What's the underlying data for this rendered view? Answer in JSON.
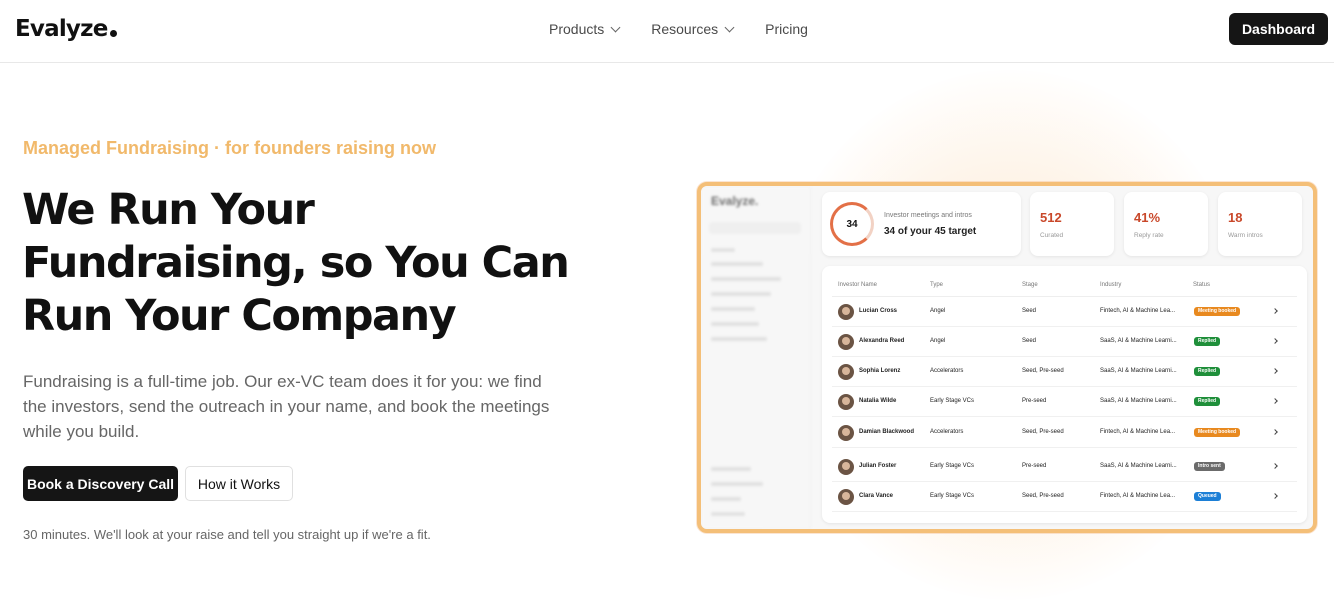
{
  "nav": {
    "logo": "Evalyze",
    "links": [
      {
        "label": "Products",
        "has_dropdown": true
      },
      {
        "label": "Resources",
        "has_dropdown": true
      },
      {
        "label": "Pricing",
        "has_dropdown": false
      }
    ],
    "dashboard_label": "Dashboard"
  },
  "hero": {
    "eyebrow": "Managed Fundraising · for founders raising now",
    "headline_lines": [
      "We Run Your",
      "Fundraising, so You Can",
      "Run Your Company"
    ],
    "subtext": "Fundraising is a full-time job. Our ex-VC team does it for you: we find the investors, send the outreach in your name, and book the meetings while you build.",
    "primary_cta": "Book a Discovery Call",
    "secondary_cta": "How it Works",
    "footnote": "30 minutes. We'll look at your raise and tell you straight up if we're a fit."
  },
  "mockup": {
    "logo": "Evalyze.",
    "progress": {
      "value": "34",
      "label": "Investor meetings and intros",
      "summary": "34 of your 45 target",
      "fraction": 0.7556
    },
    "stats": [
      {
        "value": "512",
        "label": "Curated"
      },
      {
        "value": "41%",
        "label": "Reply rate"
      },
      {
        "value": "18",
        "label": "Warm intros"
      }
    ],
    "table": {
      "headers": [
        "Investor Name",
        "Type",
        "Stage",
        "Industry",
        "Status"
      ],
      "rows": [
        {
          "name": "Lucian Cross",
          "type": "Angel",
          "stage": "Seed",
          "industry": "Fintech, AI & Machine Lea...",
          "status": "Meeting booked",
          "status_color": "#e8891f"
        },
        {
          "name": "Alexandra Reed",
          "type": "Angel",
          "stage": "Seed",
          "industry": "SaaS, AI & Machine Learni...",
          "status": "Replied",
          "status_color": "#1f8f3a"
        },
        {
          "name": "Sophia Lorenz",
          "type": "Accelerators",
          "stage": "Seed, Pre-seed",
          "industry": "SaaS, AI & Machine Learni...",
          "status": "Replied",
          "status_color": "#1f8f3a"
        },
        {
          "name": "Natalia Wilde",
          "type": "Early Stage VCs",
          "stage": "Pre-seed",
          "industry": "SaaS, AI & Machine Learni...",
          "status": "Replied",
          "status_color": "#1f8f3a"
        },
        {
          "name": "Damian Blackwood",
          "type": "Accelerators",
          "stage": "Seed, Pre-seed",
          "industry": "Fintech, AI & Machine Lea...",
          "status": "Meeting booked",
          "status_color": "#e8891f"
        },
        {
          "name": "Julian Foster",
          "type": "Early Stage VCs",
          "stage": "Pre-seed",
          "industry": "SaaS, AI & Machine Learni...",
          "status": "Intro sent",
          "status_color": "#6b6b6b"
        },
        {
          "name": "Clara Vance",
          "type": "Early Stage VCs",
          "stage": "Seed, Pre-seed",
          "industry": "Fintech, AI & Machine Lea...",
          "status": "Queued",
          "status_color": "#1c7fd6"
        }
      ]
    }
  },
  "colors": {
    "accent": "#f1b96b",
    "frame": "#f4bf78",
    "dark_button": "#151515",
    "stat_number": "#c9482a"
  },
  "icons": [
    "chevron-down-icon",
    "chevron-right-icon",
    "progress-ring-icon"
  ]
}
